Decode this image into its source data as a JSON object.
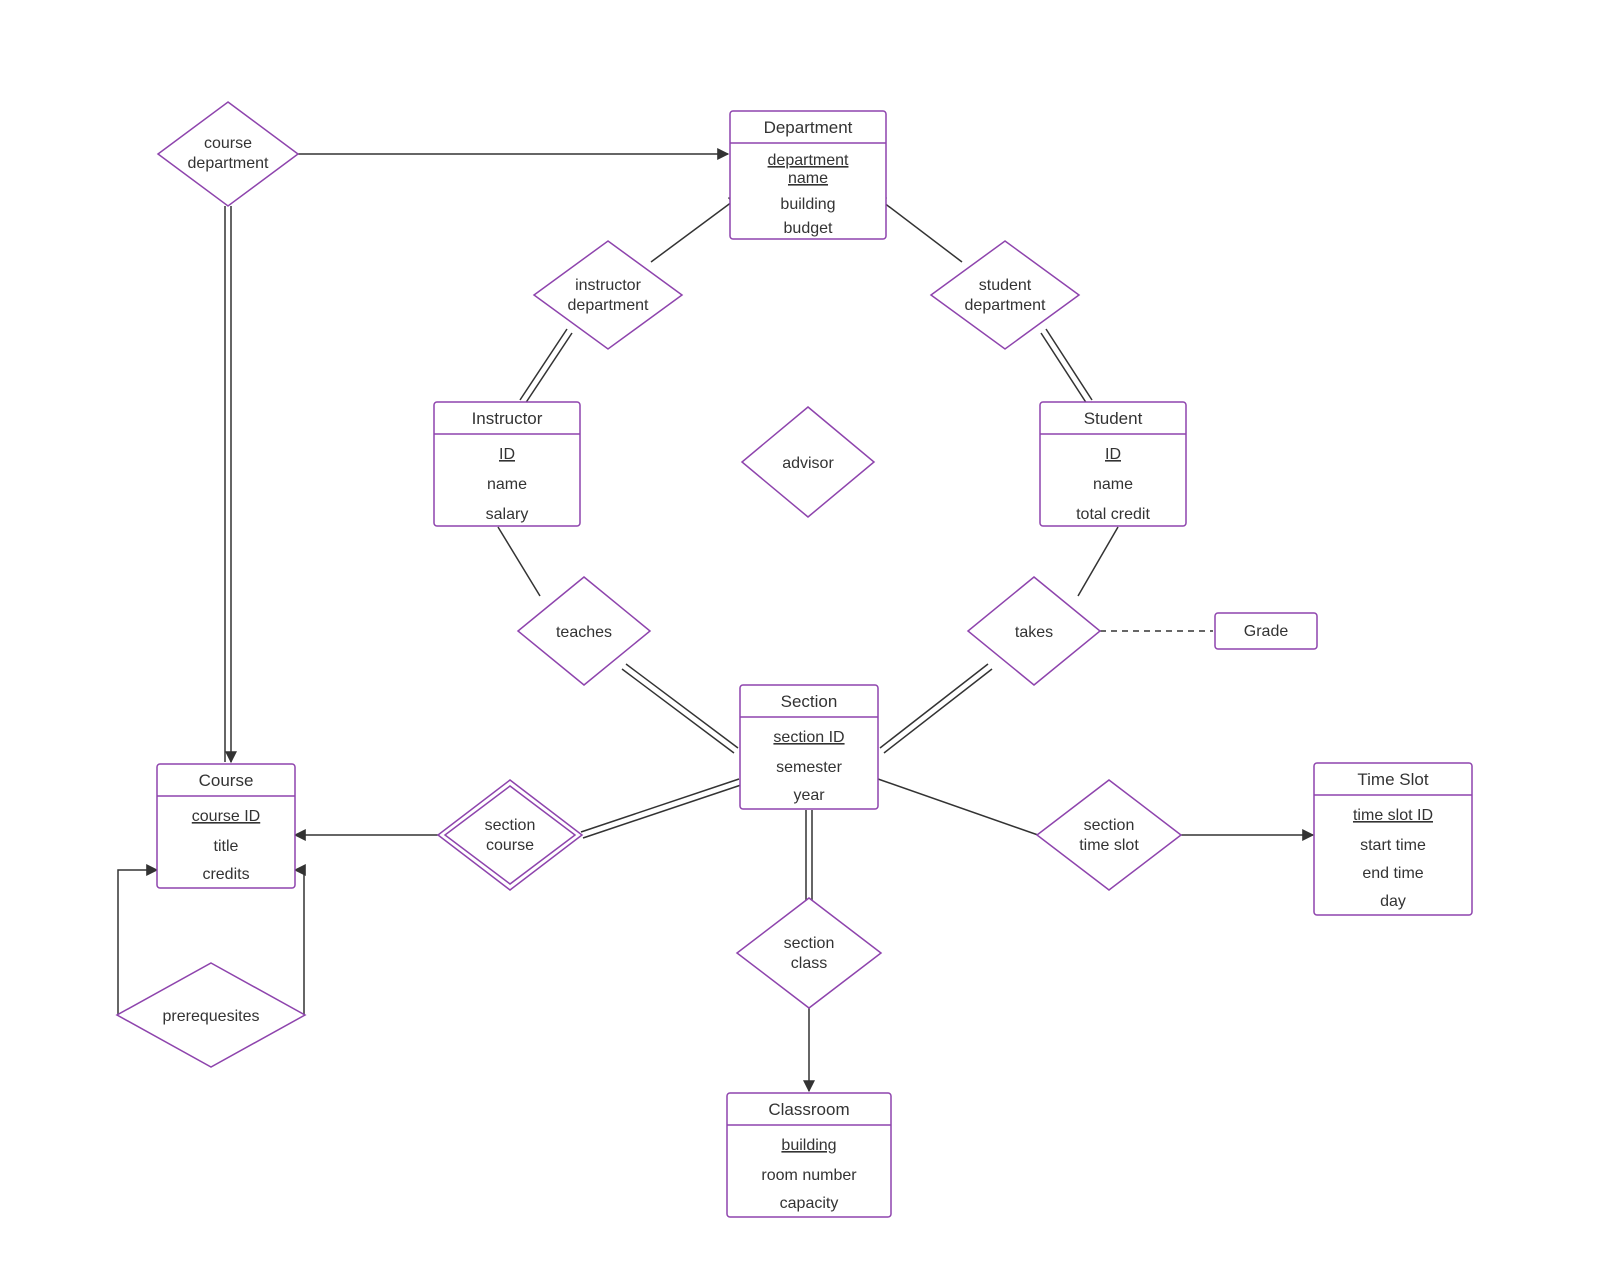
{
  "diagram_kind": "Entity-Relationship Diagram (Chen notation)",
  "entities": {
    "department": {
      "title": "Department",
      "key": "department name",
      "attrs": [
        "building",
        "budget"
      ]
    },
    "instructor": {
      "title": "Instructor",
      "key": "ID",
      "attrs": [
        "name",
        "salary"
      ]
    },
    "student": {
      "title": "Student",
      "key": "ID",
      "attrs": [
        "name",
        "total credit"
      ]
    },
    "section": {
      "title": "Section",
      "key": "section ID",
      "attrs": [
        "semester",
        "year"
      ]
    },
    "course": {
      "title": "Course",
      "key": "course ID",
      "attrs": [
        "title",
        "credits"
      ]
    },
    "classroom": {
      "title": "Classroom",
      "key": "building",
      "attrs": [
        "room number",
        "capacity"
      ]
    },
    "timeslot": {
      "title": "Time Slot",
      "key": "time slot ID",
      "attrs": [
        "start time",
        "end time",
        "day"
      ]
    },
    "gradebox": {
      "title": "Grade"
    }
  },
  "relationships": {
    "course_department": {
      "l1": "course",
      "l2": "department"
    },
    "instructor_department": {
      "l1": "instructor",
      "l2": "department"
    },
    "student_department": {
      "l1": "student",
      "l2": "department"
    },
    "advisor": {
      "l1": "advisor"
    },
    "teaches": {
      "l1": "teaches"
    },
    "takes": {
      "l1": "takes"
    },
    "section_course": {
      "l1": "section",
      "l2": "course"
    },
    "section_timeslot": {
      "l1": "section",
      "l2": "time slot"
    },
    "section_class": {
      "l1": "section",
      "l2": "class"
    },
    "prerequisites": {
      "l1": "prerequesites"
    }
  }
}
